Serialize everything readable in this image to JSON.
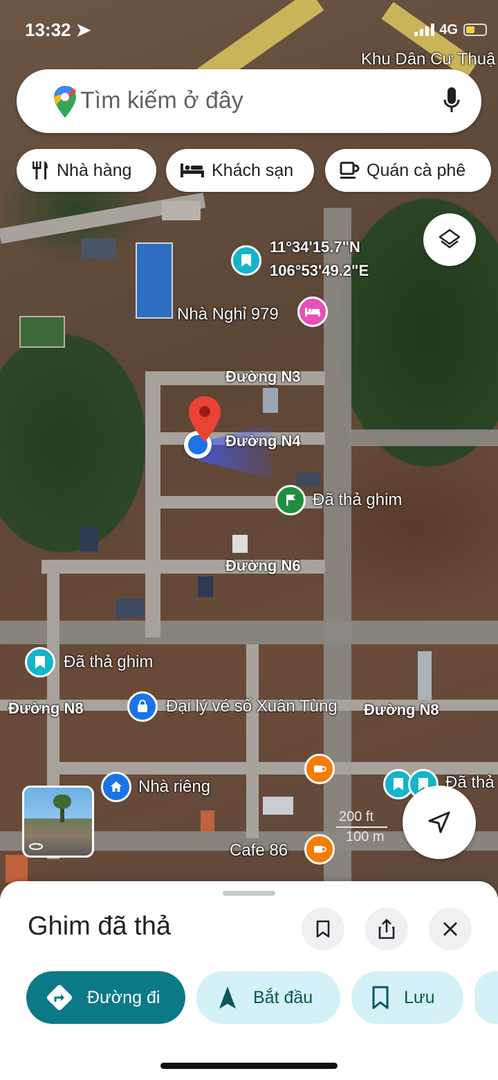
{
  "status": {
    "time": "13:32",
    "network": "4G"
  },
  "search": {
    "placeholder": "Tìm kiếm ở đây"
  },
  "chips": [
    {
      "label": "Nhà hàng",
      "icon": "restaurant-icon"
    },
    {
      "label": "Khách sạn",
      "icon": "hotel-icon"
    },
    {
      "label": "Quán cà phê",
      "icon": "coffee-icon"
    }
  ],
  "map": {
    "coords_line1": "11°34'15.7\"N",
    "coords_line2": "106°53'49.2\"E",
    "labels": {
      "top_area": "Khu Dân Cư Thuậ",
      "motel": "Nhà Nghỉ 979",
      "road_n3": "Đường N3",
      "road_n4": "Đường N4",
      "dropped_pin_1": "Đã thả ghim",
      "road_n6": "Đường N6",
      "dropped_pin_2": "Đã thả ghim",
      "road_n8_left": "Đường N8",
      "lottery": "Đại lý vé số Xuân Tùng",
      "road_n8_right": "Đường N8",
      "private_house": "Nhà riêng",
      "dropped_pin_3": "Đã thả",
      "cafe": "Cafe 86"
    },
    "scale": {
      "ft": "200 ft",
      "m": "100 m"
    }
  },
  "sheet": {
    "title": "Ghim đã thả",
    "actions": [
      {
        "label": "Đường đi",
        "icon": "directions-icon"
      },
      {
        "label": "Bắt đầu",
        "icon": "navigation-arrow-icon"
      },
      {
        "label": "Lưu",
        "icon": "bookmark-icon"
      }
    ]
  },
  "colors": {
    "teal": "#0b7a86",
    "light_teal": "#d3f1f7",
    "poi_teal": "#12b5cb",
    "pink": "#e94fb6",
    "orange": "#f57c00",
    "pin_red": "#ea4335",
    "blue_dot": "#1a73e8"
  }
}
